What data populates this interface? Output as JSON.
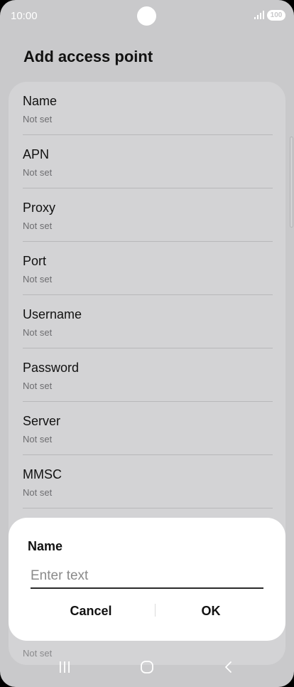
{
  "status_bar": {
    "time": "10:00",
    "battery": "100",
    "icons": [
      "signal-icon",
      "battery-icon"
    ]
  },
  "page": {
    "title": "Add access point"
  },
  "fields": [
    {
      "label": "Name",
      "value": "Not set"
    },
    {
      "label": "APN",
      "value": "Not set"
    },
    {
      "label": "Proxy",
      "value": "Not set"
    },
    {
      "label": "Port",
      "value": "Not set"
    },
    {
      "label": "Username",
      "value": "Not set"
    },
    {
      "label": "Password",
      "value": "Not set"
    },
    {
      "label": "Server",
      "value": "Not set"
    },
    {
      "label": "MMSC",
      "value": "Not set"
    }
  ],
  "obscured_value": "Not set",
  "dialog": {
    "title": "Name",
    "input_value": "",
    "input_placeholder": "Enter text",
    "cancel_label": "Cancel",
    "ok_label": "OK"
  },
  "nav_bar": {
    "icons": [
      "recents-icon",
      "home-icon",
      "back-icon"
    ]
  },
  "colors": {
    "dimmed_background": "#c9c9cb",
    "card": "#d3d3d5",
    "dialog": "#ffffff",
    "text_primary": "#111111",
    "text_secondary": "#6d6d70"
  }
}
